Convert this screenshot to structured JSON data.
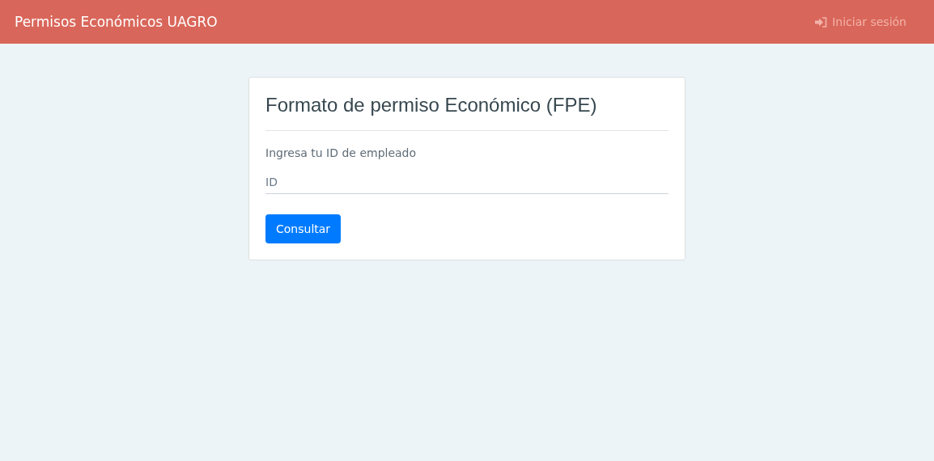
{
  "navbar": {
    "brand": "Permisos Económicos UAGRO",
    "login_link": "Iniciar sesión"
  },
  "card": {
    "title": "Formato de permiso Económico (FPE)",
    "label": "Ingresa tu ID de empleado",
    "field": {
      "placeholder": "ID"
    },
    "button": "Consultar"
  }
}
